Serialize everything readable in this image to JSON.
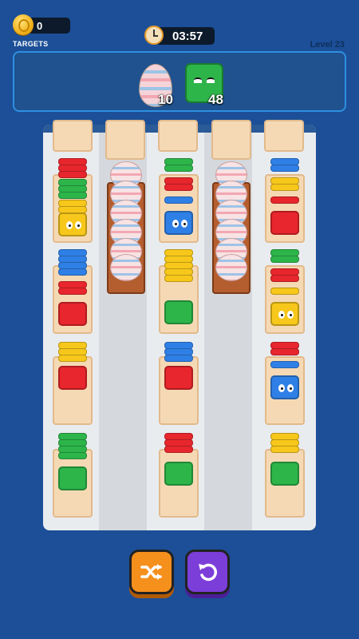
{
  "hud": {
    "coins": "0",
    "targets_label": "TARGETS",
    "timer": "03:57",
    "level": "Level 23"
  },
  "targets": [
    {
      "item": "striped-egg",
      "count": "10"
    },
    {
      "item": "green-cube",
      "count": "48"
    }
  ],
  "colors": {
    "background": "#1c4f97",
    "red": "#e8262d",
    "green": "#2db54a",
    "blue": "#2f80e6",
    "yellow": "#f7c81b",
    "shuffle_button": "#f6901d",
    "undo_button": "#7c3ed9"
  },
  "buttons": {
    "shuffle_icon": "shuffle-icon",
    "undo_icon": "undo-icon"
  }
}
